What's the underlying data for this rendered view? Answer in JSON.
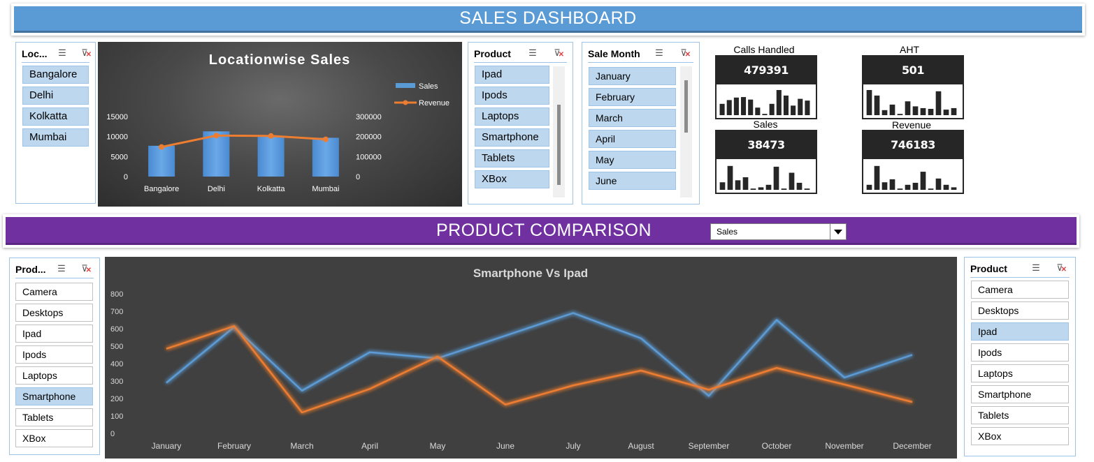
{
  "sales_header": {
    "title": "SALES DASHBOARD"
  },
  "location_slicer": {
    "title": "Loc...",
    "items": [
      "Bangalore",
      "Delhi",
      "Kolkatta",
      "Mumbai"
    ]
  },
  "location_chart": {
    "title": "Locationwise Sales",
    "legend": [
      "Sales",
      "Revenue"
    ]
  },
  "product_slicer_top": {
    "title": "Product",
    "items": [
      "Ipad",
      "Ipods",
      "Laptops",
      "Smartphone",
      "Tablets",
      "XBox"
    ]
  },
  "month_slicer": {
    "title": "Sale Month",
    "items": [
      "January",
      "February",
      "March",
      "April",
      "May",
      "June"
    ]
  },
  "kpis": [
    {
      "label": "Calls Handled",
      "value": "479391",
      "spark": [
        0.45,
        0.6,
        0.7,
        0.72,
        0.62,
        0.3,
        0.05,
        0.45,
        1.0,
        0.78,
        0.38,
        0.65,
        0.58
      ]
    },
    {
      "label": "AHT",
      "value": "501",
      "spark": [
        1.0,
        0.78,
        0.2,
        0.42,
        0.05,
        0.55,
        0.35,
        0.28,
        0.25,
        0.95,
        0.22,
        0.28
      ]
    },
    {
      "label": "Sales",
      "value": "38473",
      "spark": [
        0.3,
        0.95,
        0.38,
        0.5,
        0.05,
        0.1,
        0.2,
        0.92,
        0.05,
        0.68,
        0.28,
        0.05
      ]
    },
    {
      "label": "Revenue",
      "value": "746183",
      "spark": [
        0.2,
        0.95,
        0.3,
        0.42,
        0.05,
        0.2,
        0.28,
        0.72,
        0.05,
        0.45,
        0.2,
        0.1
      ]
    }
  ],
  "comparison_header": {
    "title": "PRODUCT COMPARISON"
  },
  "metric_dropdown": {
    "value": "Sales"
  },
  "compare_slicer_left": {
    "title": "Prod...",
    "items": [
      "Camera",
      "Desktops",
      "Ipad",
      "Ipods",
      "Laptops",
      "Smartphone",
      "Tablets",
      "XBox"
    ],
    "selected": "Smartphone"
  },
  "compare_slicer_right": {
    "title": "Product",
    "items": [
      "Camera",
      "Desktops",
      "Ipad",
      "Ipods",
      "Laptops",
      "Smartphone",
      "Tablets",
      "XBox"
    ],
    "selected": "Ipad"
  },
  "colors": {
    "blue": "#5b9bd5",
    "orange": "#ed7d31",
    "purple": "#7030a0",
    "slicer_selected": "#bdd7ee"
  },
  "chart_data": [
    {
      "type": "bar",
      "title": "Locationwise Sales",
      "categories": [
        "Bangalore",
        "Delhi",
        "Kolkatta",
        "Mumbai"
      ],
      "series": [
        {
          "name": "Sales",
          "type": "bar",
          "axis": "left",
          "values": [
            7700,
            11300,
            10000,
            9700
          ]
        },
        {
          "name": "Revenue",
          "type": "line",
          "axis": "right",
          "values": [
            148000,
            205000,
            203000,
            186000
          ]
        }
      ],
      "ylim": [
        0,
        15000
      ],
      "y_ticks": [
        "0",
        "5000",
        "10000",
        "15000"
      ],
      "y2lim": [
        0,
        300000
      ],
      "y2_ticks": [
        "0",
        "100000",
        "200000",
        "300000"
      ],
      "legend_position": "right"
    },
    {
      "type": "line",
      "title": "Smartphone Vs Ipad",
      "categories": [
        "January",
        "February",
        "March",
        "April",
        "May",
        "June",
        "July",
        "August",
        "September",
        "October",
        "November",
        "December"
      ],
      "series": [
        {
          "values": [
            290,
            610,
            245,
            465,
            430,
            560,
            690,
            545,
            215,
            650,
            320,
            450
          ],
          "color": "#5b9bd5"
        },
        {
          "values": [
            485,
            615,
            120,
            255,
            440,
            165,
            275,
            360,
            250,
            375,
            280,
            180
          ],
          "color": "#ed7d31"
        }
      ],
      "ylim": [
        0,
        800
      ],
      "y_ticks": [
        "0",
        "100",
        "200",
        "300",
        "400",
        "500",
        "600",
        "700",
        "800"
      ],
      "grid": false
    }
  ]
}
